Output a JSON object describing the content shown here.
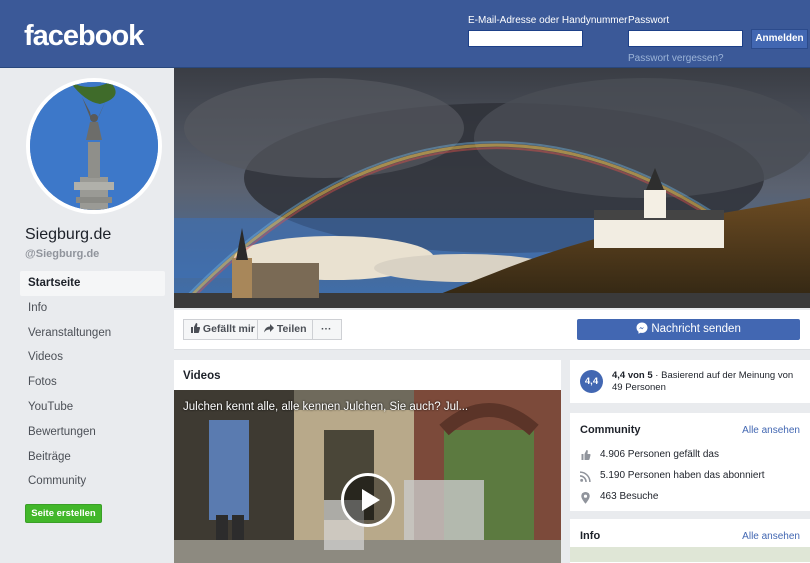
{
  "header": {
    "logo": "facebook",
    "email_label": "E-Mail-Adresse oder Handynummer",
    "password_label": "Passwort",
    "login_button": "Anmelden",
    "forgot_password": "Passwort vergessen?"
  },
  "profile": {
    "name": "Siegburg.de",
    "handle": "@Siegburg.de"
  },
  "nav": {
    "items": [
      {
        "label": "Startseite",
        "active": true
      },
      {
        "label": "Info"
      },
      {
        "label": "Veranstaltungen"
      },
      {
        "label": "Videos"
      },
      {
        "label": "Fotos"
      },
      {
        "label": "YouTube"
      },
      {
        "label": "Bewertungen"
      },
      {
        "label": "Beiträge"
      },
      {
        "label": "Community"
      }
    ],
    "create_page": "Seite erstellen"
  },
  "actions": {
    "like": "Gefällt mir",
    "share": "Teilen",
    "more": "···",
    "message": "Nachricht senden"
  },
  "videos": {
    "heading": "Videos",
    "video_title": "Julchen kennt alle, alle kennen Julchen, Sie auch? Jul..."
  },
  "rating": {
    "score": "4,4",
    "text_bold": "4,4 von 5",
    "text": " · Basierend auf der Meinung von 49 Personen"
  },
  "community": {
    "heading": "Community",
    "see_all": "Alle ansehen",
    "likes": "4.906 Personen gefällt das",
    "followers": "5.190 Personen haben das abonniert",
    "checkins": "463 Besuche"
  },
  "info": {
    "heading": "Info",
    "see_all": "Alle ansehen"
  },
  "colors": {
    "brand": "#3b5998",
    "button_blue": "#4267b2",
    "create_green": "#42b72a"
  }
}
